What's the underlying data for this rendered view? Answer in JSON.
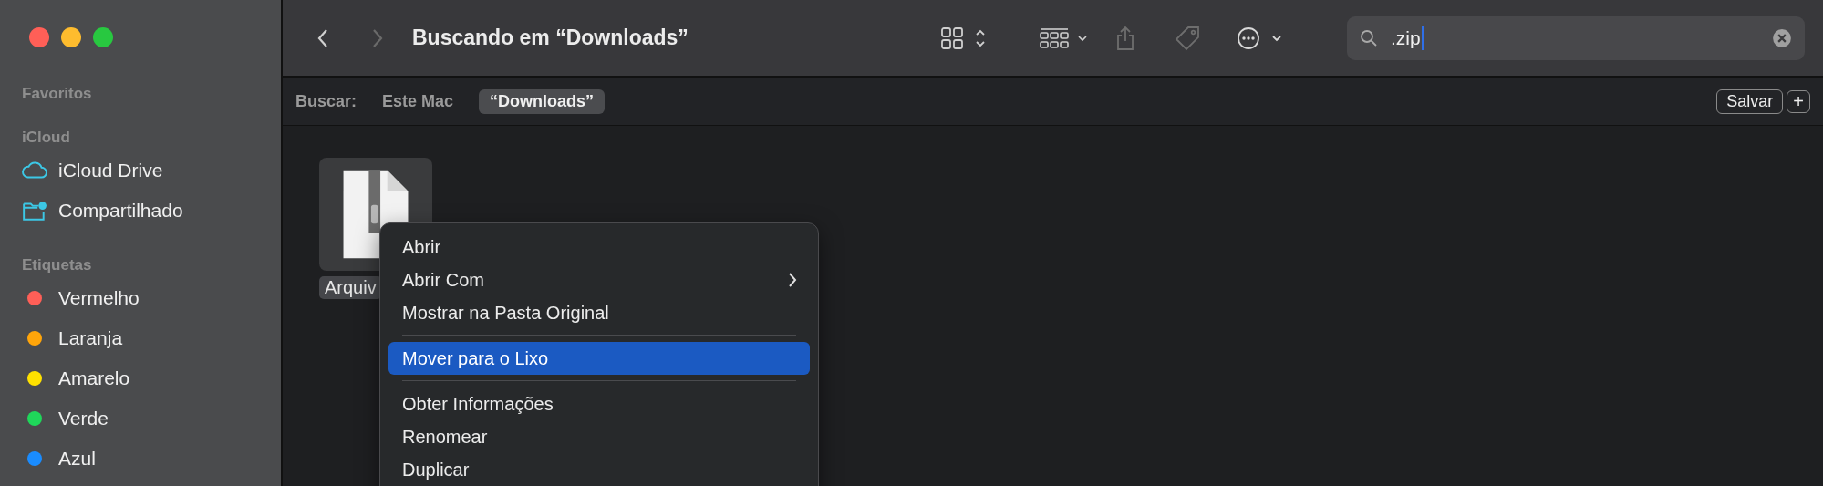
{
  "sidebar": {
    "sections": [
      {
        "heading": "Favoritos"
      },
      {
        "heading": "iCloud",
        "items": [
          {
            "label": "iCloud Drive",
            "kind": "cloud"
          },
          {
            "label": "Compartilhado",
            "kind": "shared"
          }
        ]
      },
      {
        "heading": "Etiquetas",
        "items": [
          {
            "label": "Vermelho",
            "kind": "tag",
            "color": "#ff5f57"
          },
          {
            "label": "Laranja",
            "kind": "tag",
            "color": "#ffa50a"
          },
          {
            "label": "Amarelo",
            "kind": "tag",
            "color": "#ffe100"
          },
          {
            "label": "Verde",
            "kind": "tag",
            "color": "#1fd75a"
          },
          {
            "label": "Azul",
            "kind": "tag",
            "color": "#1a8cff"
          }
        ]
      }
    ]
  },
  "toolbar": {
    "title": "Buscando em “Downloads”",
    "search": {
      "value": ".zip"
    }
  },
  "scope_bar": {
    "label": "Buscar:",
    "options": [
      {
        "label": "Este Mac",
        "selected": false
      },
      {
        "label": "“Downloads”",
        "selected": true
      }
    ],
    "save_button": "Salvar",
    "add_button": "+"
  },
  "files": [
    {
      "name": "Arquiv",
      "selected": true
    }
  ],
  "context_menu": {
    "items": [
      {
        "kind": "item",
        "label": "Abrir",
        "submenu": false,
        "selected": false
      },
      {
        "kind": "item",
        "label": "Abrir Com",
        "submenu": true,
        "selected": false
      },
      {
        "kind": "item",
        "label": "Mostrar na Pasta Original",
        "submenu": false,
        "selected": false
      },
      {
        "kind": "separator"
      },
      {
        "kind": "item",
        "label": "Mover para o Lixo",
        "submenu": false,
        "selected": true
      },
      {
        "kind": "separator"
      },
      {
        "kind": "item",
        "label": "Obter Informações",
        "submenu": false,
        "selected": false
      },
      {
        "kind": "item",
        "label": "Renomear",
        "submenu": false,
        "selected": false
      },
      {
        "kind": "item",
        "label": "Duplicar",
        "submenu": false,
        "selected": false
      }
    ]
  }
}
